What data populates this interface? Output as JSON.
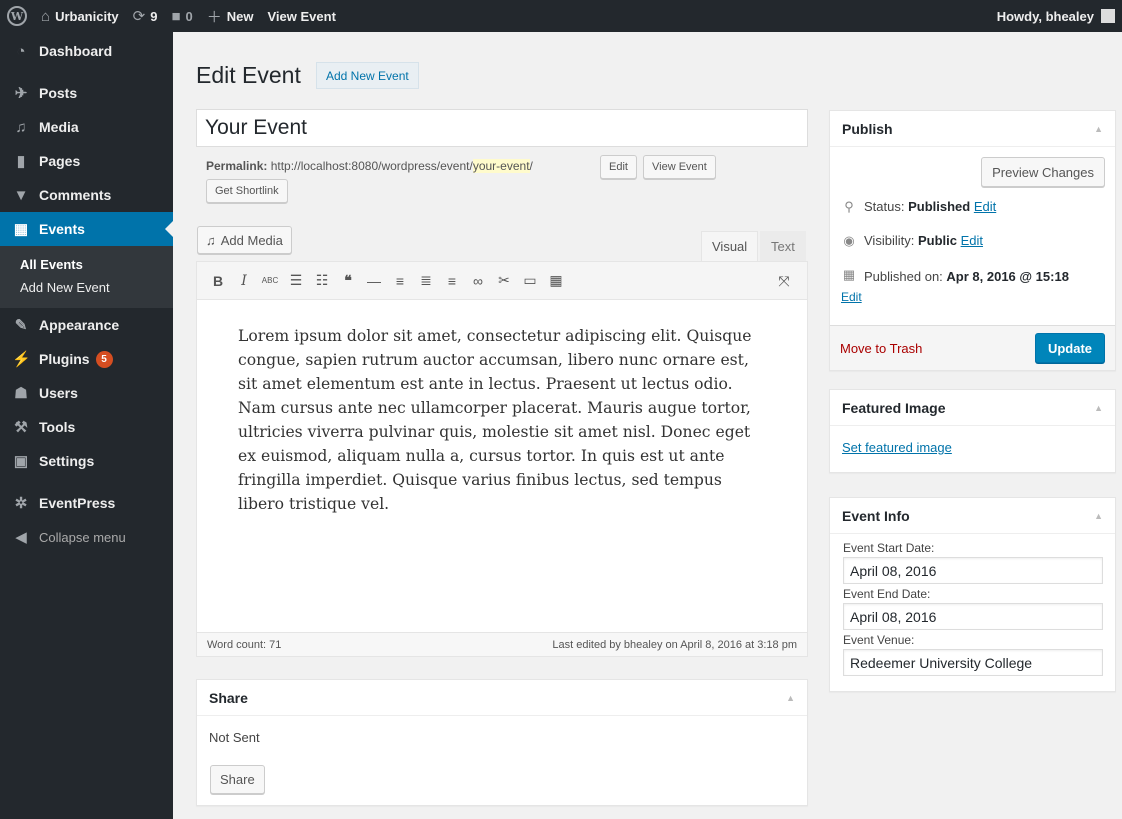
{
  "adminbar": {
    "site_name": "Urbanicity",
    "updates_count": "9",
    "comments_count": "0",
    "new_label": "New",
    "view_event_label": "View Event",
    "howdy": "Howdy, bhealey"
  },
  "sidebar": {
    "items": [
      {
        "label": "Dashboard",
        "icon": "dashboard-icon"
      },
      {
        "label": "Posts",
        "icon": "pin-icon"
      },
      {
        "label": "Media",
        "icon": "media-icon"
      },
      {
        "label": "Pages",
        "icon": "pages-icon"
      },
      {
        "label": "Comments",
        "icon": "comments-icon"
      },
      {
        "label": "Events",
        "icon": "calendar-icon"
      },
      {
        "label": "Appearance",
        "icon": "brush-icon"
      },
      {
        "label": "Plugins",
        "icon": "plugin-icon",
        "badge": "5"
      },
      {
        "label": "Users",
        "icon": "users-icon"
      },
      {
        "label": "Tools",
        "icon": "wrench-icon"
      },
      {
        "label": "Settings",
        "icon": "settings-icon"
      },
      {
        "label": "EventPress",
        "icon": "gear-icon"
      },
      {
        "label": "Collapse menu",
        "icon": "collapse-icon"
      }
    ],
    "submenu": [
      "All Events",
      "Add New Event"
    ]
  },
  "page": {
    "title": "Edit Event",
    "add_new": "Add New Event"
  },
  "post": {
    "title_value": "Your Event",
    "permalink_label": "Permalink:",
    "permalink_base": "http://localhost:8080/wordpress/event/",
    "permalink_slug": "your-event",
    "permalink_trail": "/",
    "edit_btn": "Edit",
    "view_btn": "View Event",
    "shortlink_btn": "Get Shortlink"
  },
  "editor": {
    "add_media": "Add Media",
    "tab_visual": "Visual",
    "tab_text": "Text",
    "content": "Lorem ipsum dolor sit amet, consectetur adipiscing elit. Quisque congue, sapien rutrum auctor accumsan, libero nunc ornare est, sit amet elementum est ante in lectus. Praesent ut lectus odio. Nam cursus ante nec ullamcorper placerat. Mauris augue tortor, ultricies viverra pulvinar quis, molestie sit amet nisl. Donec eget ex euismod, aliquam nulla a, cursus tortor. In quis est ut ante fringilla imperdiet. Quisque varius finibus lectus, sed tempus libero tristique vel.",
    "word_count": "Word count: 71",
    "last_edited": "Last edited by bhealey on April 8, 2016 at 3:18 pm"
  },
  "share": {
    "title": "Share",
    "status": "Not Sent",
    "button": "Share"
  },
  "publish": {
    "title": "Publish",
    "preview": "Preview Changes",
    "status_label": "Status:",
    "status_value": "Published",
    "visibility_label": "Visibility:",
    "visibility_value": "Public",
    "published_label": "Published on:",
    "published_value": "Apr 8, 2016 @ 15:18",
    "edit_link": "Edit",
    "trash": "Move to Trash",
    "update": "Update"
  },
  "featured": {
    "title": "Featured Image",
    "link": "Set featured image"
  },
  "event_info": {
    "title": "Event Info",
    "start_label": "Event Start Date:",
    "start_value": "April 08, 2016",
    "end_label": "Event End Date:",
    "end_value": "April 08, 2016",
    "venue_label": "Event Venue:",
    "venue_value": "Redeemer University College"
  },
  "colors": {
    "admin_dark": "#23282d",
    "accent": "#0073aa",
    "update_button": "#0085ba",
    "badge": "#d54e21",
    "trash": "#aa0000"
  }
}
